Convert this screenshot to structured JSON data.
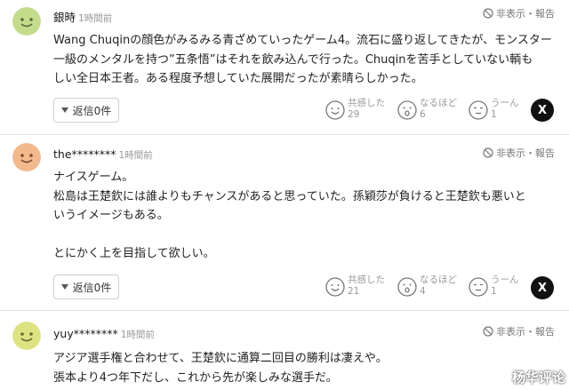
{
  "comments": [
    {
      "username": "銀時",
      "time": "1時間前",
      "report": "非表示・報告",
      "lines": [
        "Wang Chuqinの顔色がみるみる青ざめていったゲーム4。流石に盛り返してきたが、モンスター",
        "一級のメンタルを持つ”五条悟”はそれを飲み込んで行った。Chuqinを苦手としていない輌も",
        "しい全日本王者。ある程度予想していた展開だったが素晴らしかった。"
      ],
      "reply": "返信0件",
      "reactions": [
        {
          "label": "共感した",
          "count": "29"
        },
        {
          "label": "なるほど",
          "count": "6"
        },
        {
          "label": "うーん",
          "count": "1"
        }
      ],
      "share": "X"
    },
    {
      "username": "the********",
      "time": "1時間前",
      "report": "非表示・報告",
      "lines": [
        "ナイスゲーム。",
        "松島は王楚欽には誰よりもチャンスがあると思っていた。孫穎莎が負けると王楚欽も悪いと",
        "いうイメージもある。",
        "",
        "とにかく上を目指して欲しい。"
      ],
      "reply": "返信0件",
      "reactions": [
        {
          "label": "共感した",
          "count": "21"
        },
        {
          "label": "なるほど",
          "count": "4"
        },
        {
          "label": "うーん",
          "count": "1"
        }
      ],
      "share": "X"
    },
    {
      "username": "yuy********",
      "time": "1時間前",
      "report": "非表示・報告",
      "lines": [
        "アジア選手権と合わせて、王楚欽に通算二回目の勝利は凄えや。",
        "張本より4つ年下だし、これから先が楽しみな選手だ。"
      ]
    }
  ],
  "watermark": "杨华评论",
  "colors": {
    "avatar_green": "#c3dc8c",
    "avatar_orange": "#f2b98d",
    "avatar_yellow": "#dde383",
    "x_button": "#111111",
    "muted_text": "#999999"
  },
  "icons": {
    "report": "circle-slash-icon",
    "reply": "triangle-down-icon",
    "reaction_1": "smile-face-icon",
    "reaction_2": "surprised-face-icon",
    "reaction_3": "hmm-face-icon",
    "share": "x-logo-icon"
  }
}
